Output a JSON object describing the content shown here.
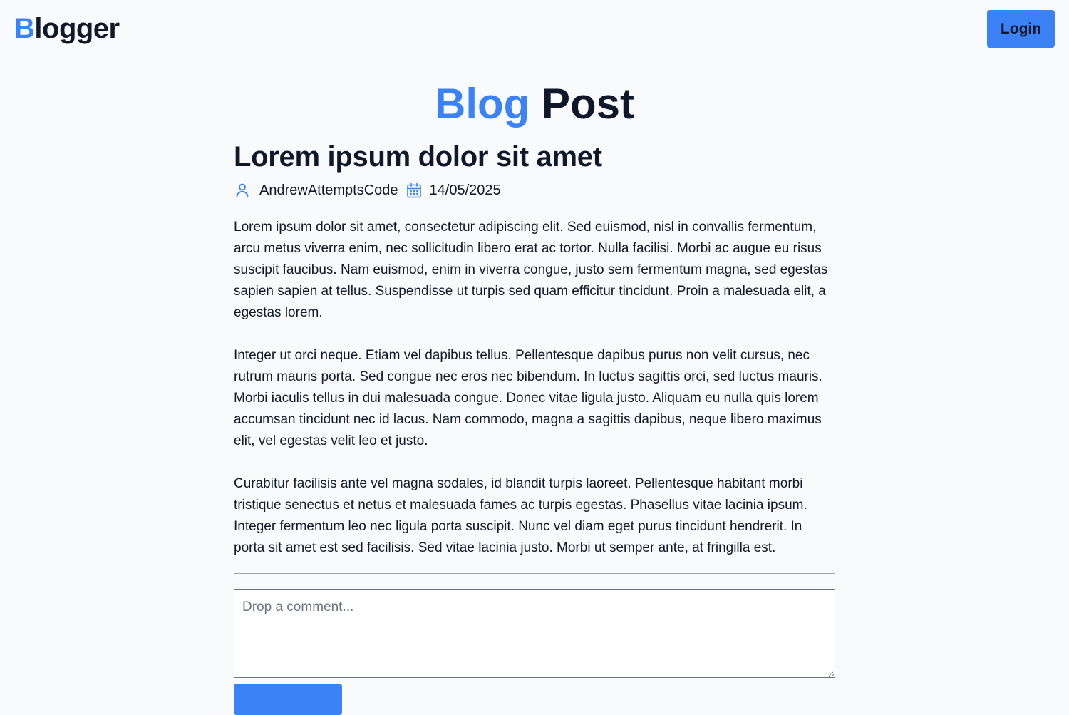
{
  "header": {
    "logo_first_letter": "B",
    "logo_rest": "logger",
    "login_label": "Login"
  },
  "page_title": {
    "accent": "Blog",
    "rest": "Post"
  },
  "post": {
    "title": "Lorem ipsum dolor sit amet",
    "author": "AndrewAttemptsCode",
    "date": "14/05/2025",
    "paragraphs": [
      "Lorem ipsum dolor sit amet, consectetur adipiscing elit. Sed euismod, nisl in convallis fermentum, arcu metus viverra enim, nec sollicitudin libero erat ac tortor. Nulla facilisi. Morbi ac augue eu risus suscipit faucibus. Nam euismod, enim in viverra congue, justo sem fermentum magna, sed egestas sapien sapien at tellus. Suspendisse ut turpis sed quam efficitur tincidunt. Proin a malesuada elit, a egestas lorem.",
      "Integer ut orci neque. Etiam vel dapibus tellus. Pellentesque dapibus purus non velit cursus, nec rutrum mauris porta. Sed congue nec eros nec bibendum. In luctus sagittis orci, sed luctus mauris. Morbi iaculis tellus in dui malesuada congue. Donec vitae ligula justo. Aliquam eu nulla quis lorem accumsan tincidunt nec id lacus. Nam commodo, magna a sagittis dapibus, neque libero maximus elit, vel egestas velit leo et justo.",
      "Curabitur facilisis ante vel magna sodales, id blandit turpis laoreet. Pellentesque habitant morbi tristique senectus et netus et malesuada fames ac turpis egestas. Phasellus vitae lacinia ipsum. Integer fermentum leo nec ligula porta suscipit. Nunc vel diam eget purus tincidunt hendrerit. In porta sit amet est sed facilisis. Sed vitae lacinia justo. Morbi ut semper ante, at fringilla est."
    ]
  },
  "comment": {
    "placeholder": "Drop a comment...",
    "value": ""
  },
  "icons": {
    "author": "user-icon",
    "date": "calendar-icon"
  },
  "colors": {
    "accent": "#3b82f6",
    "text": "#0f172a",
    "background": "#f8fafc"
  }
}
